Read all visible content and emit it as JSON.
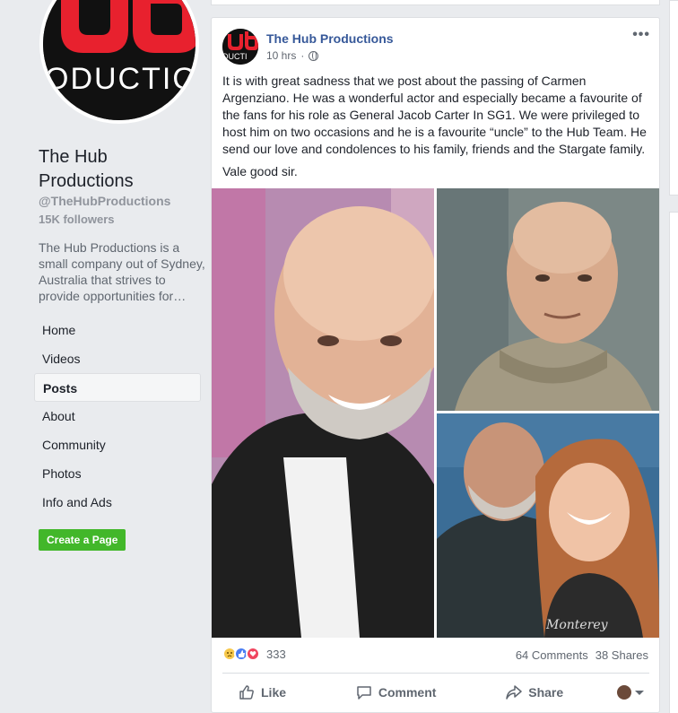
{
  "page": {
    "name": "The Hub Productions",
    "handle": "@TheHubProductions",
    "followers": "15K followers",
    "about": "The Hub Productions is a small company out of Sydney, Australia that strives to provide opportunities for…",
    "logo_text": "ODUCTIO",
    "create_label": "Create a Page",
    "brand_color": "#e8212e"
  },
  "nav": {
    "items": [
      {
        "label": "Home"
      },
      {
        "label": "Videos"
      },
      {
        "label": "Posts"
      },
      {
        "label": "About"
      },
      {
        "label": "Community"
      },
      {
        "label": "Photos"
      },
      {
        "label": "Info and Ads"
      }
    ],
    "active": "Posts"
  },
  "post": {
    "author": "The Hub Productions",
    "time": "10 hrs",
    "time_sep": "·",
    "avatar_text": "DUCTI",
    "paragraph1": "It is with great sadness that we post about the passing of Carmen Argenziano. He was a wonderful actor and especially became a favourite of the fans for his role as General Jacob Carter In SG1. We were privileged to host him on two occasions and he is a favourite “uncle” to the Hub Team. He send our love and condolences to his family, friends and the Stargate family.",
    "paragraph2": "Vale good sir.",
    "photo3_caption": "Monterey"
  },
  "stats": {
    "reactions_count": "333",
    "comments": "64 Comments",
    "shares": "38 Shares"
  },
  "actions": {
    "like": "Like",
    "comment": "Comment",
    "share": "Share"
  },
  "icons": [
    "globe-icon",
    "more-icon",
    "sad-reaction-icon",
    "like-reaction-icon",
    "love-reaction-icon",
    "like-icon",
    "comment-icon",
    "share-icon",
    "chevron-down-icon"
  ]
}
